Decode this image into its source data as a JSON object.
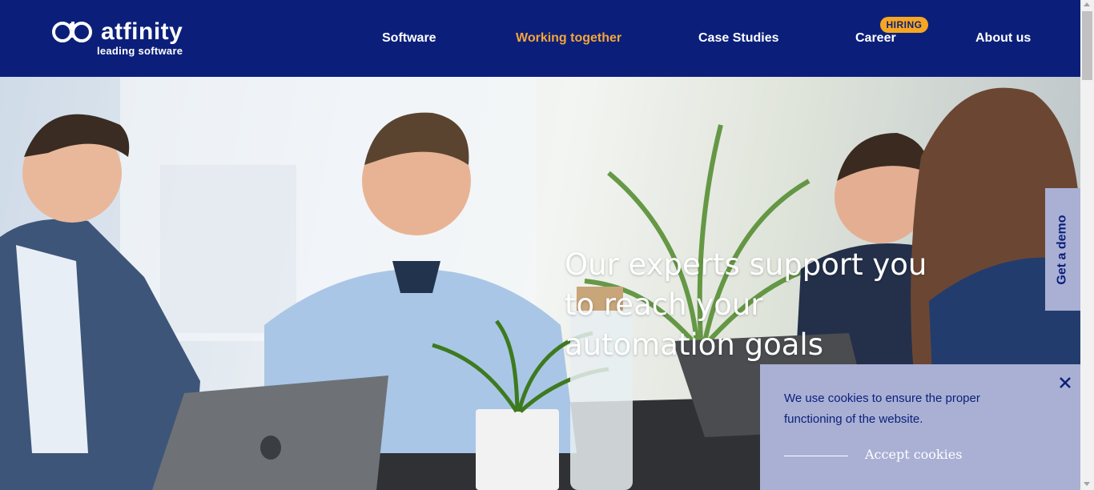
{
  "brand": {
    "name": "atfinity",
    "tagline": "leading software",
    "logo_icon": "ab-infinity-logo-icon"
  },
  "nav": {
    "items": [
      {
        "label": "Software"
      },
      {
        "label": "Working together",
        "active": true
      },
      {
        "label": "Case Studies"
      },
      {
        "label": "Career"
      },
      {
        "label": "About us"
      }
    ],
    "career_badge": "HIRING"
  },
  "hero": {
    "headline": "Our experts support you to reach your automation goals",
    "image": "team-meeting-photo"
  },
  "demo_tab": {
    "label": "Get a demo"
  },
  "cookie_banner": {
    "message": "We use cookies to ensure the proper functioning of the website.",
    "accept_label": "Accept cookies",
    "close_icon": "close-icon"
  },
  "colors": {
    "header_bg": "#0b1f7a",
    "active_nav": "#f4a53a",
    "badge_bg": "#f5a623",
    "panel_bg": "#a9b0d4"
  }
}
